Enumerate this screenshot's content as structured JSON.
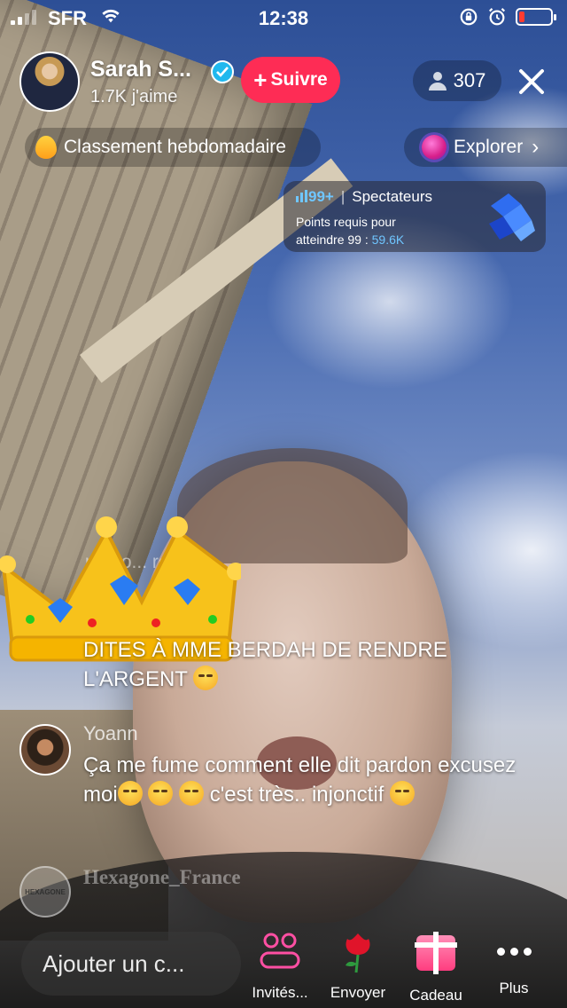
{
  "status_bar": {
    "carrier": "SFR",
    "time": "12:38",
    "battery_level": 0.15,
    "battery_color": "#ff3b30"
  },
  "host": {
    "name": "Sarah S...",
    "likes": "1.7K j'aime",
    "verified": true,
    "follow_label": "Suivre",
    "follow_color": "#fe2c55"
  },
  "viewers": {
    "count": "307"
  },
  "top_pills": {
    "ranking_label": "Classement hebdomadaire",
    "explore_label": "Explorer"
  },
  "spectators_card": {
    "rank": "99+",
    "separator": "|",
    "title": "Spectateurs",
    "line1": "Points requis pour",
    "line2_prefix": "atteindre 99 :",
    "points": "59.6K",
    "points_color": "#6fc6ff"
  },
  "chat": {
    "faded_text": "p... to... réseau",
    "messages": [
      {
        "user": "",
        "text": "DITES À MME BERDAH DE RENDRE L'ARGENT",
        "emoji_count": 1
      },
      {
        "user": "Yoann",
        "text_before": "Ça me fume comment elle dit pardon excusez moi",
        "emoji_count_before": 3,
        "text_after": "c'est très.. injonctif",
        "emoji_count_after": 1
      }
    ],
    "faded_user": "Hexagone_France",
    "faded_avatar_text": "HEXAGONE"
  },
  "bottom_bar": {
    "input_placeholder": "Ajouter un c...",
    "actions": [
      {
        "label": "Invités...",
        "icon": "people-icon"
      },
      {
        "label": "Envoyer",
        "icon": "rose-icon"
      },
      {
        "label": "Cadeau",
        "icon": "gift-icon"
      },
      {
        "label": "Plus",
        "icon": "more-icon"
      }
    ]
  }
}
